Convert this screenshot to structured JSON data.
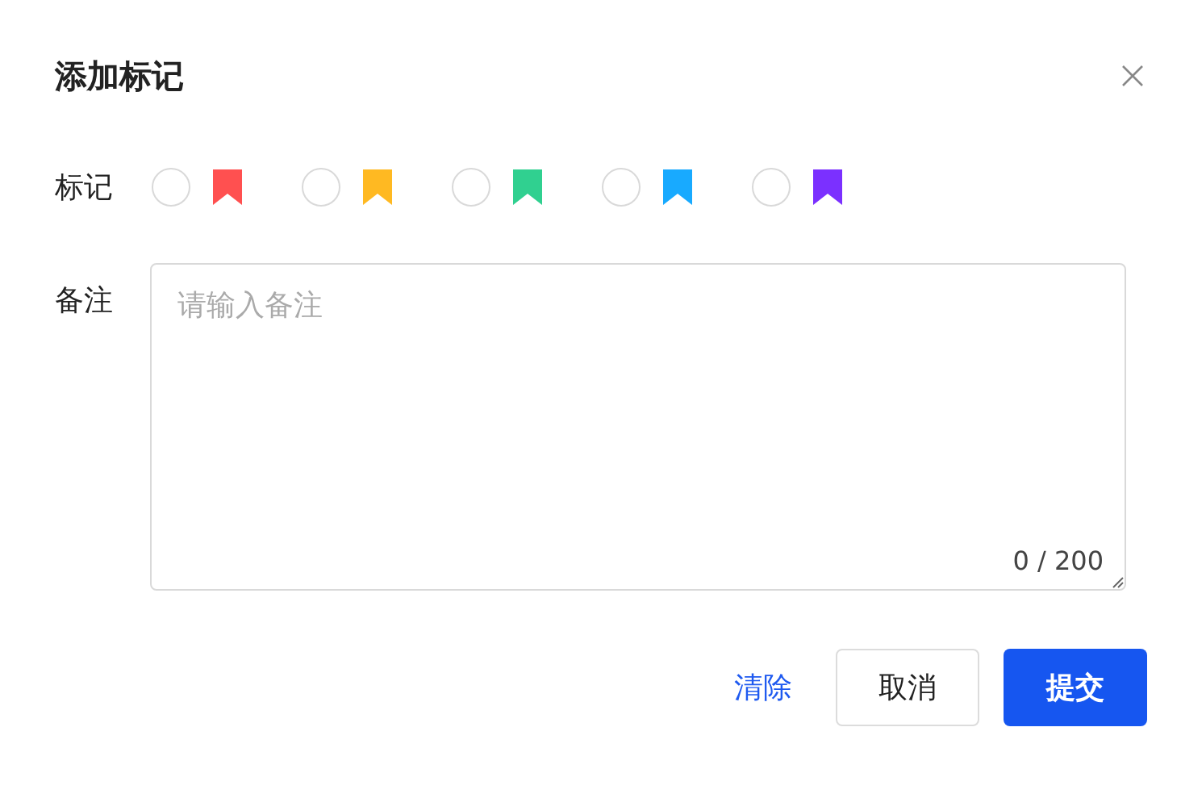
{
  "dialog": {
    "title": "添加标记"
  },
  "marks": {
    "label": "标记",
    "options": [
      {
        "selected": false,
        "color": "#ff5050"
      },
      {
        "selected": false,
        "color": "#ffb922"
      },
      {
        "selected": false,
        "color": "#30d090"
      },
      {
        "selected": false,
        "color": "#18aaff"
      },
      {
        "selected": false,
        "color": "#7b30ff"
      }
    ]
  },
  "note": {
    "label": "备注",
    "placeholder": "请输入备注",
    "counter": "0 / 200"
  },
  "buttons": [
    {
      "kind": "link",
      "label": "清除"
    },
    {
      "kind": "default",
      "label": "取消"
    },
    {
      "kind": "primary",
      "label": "提交"
    }
  ]
}
